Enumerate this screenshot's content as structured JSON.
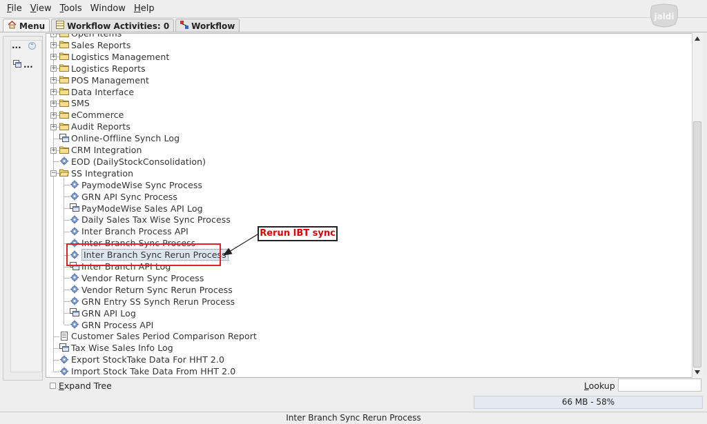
{
  "menubar": {
    "items": [
      {
        "key": "F",
        "rest": "ile"
      },
      {
        "key": "V",
        "rest": "iew"
      },
      {
        "key": "T",
        "rest": "ools"
      },
      {
        "key": "W",
        "rest": "indow",
        "nounderline": true
      },
      {
        "key": "H",
        "rest": "elp"
      }
    ]
  },
  "logo_text": "jaldi",
  "tabs": {
    "menu": "Menu",
    "workflow_activities": "Workflow Activities: 0",
    "workflow": "Workflow"
  },
  "side": {
    "dots_top": "...",
    "dots_item": "..."
  },
  "tree": {
    "items": [
      {
        "label": "Open Items",
        "type": "folder",
        "level": 0,
        "expandable": true,
        "partial": true
      },
      {
        "label": "Sales Reports",
        "type": "folder",
        "level": 0,
        "expandable": true
      },
      {
        "label": "Logistics Management",
        "type": "folder",
        "level": 0,
        "expandable": true
      },
      {
        "label": "Logistics Reports",
        "type": "folder",
        "level": 0,
        "expandable": true
      },
      {
        "label": "POS Management",
        "type": "folder",
        "level": 0,
        "expandable": true
      },
      {
        "label": "Data Interface",
        "type": "folder",
        "level": 0,
        "expandable": true
      },
      {
        "label": "SMS",
        "type": "folder",
        "level": 0,
        "expandable": true
      },
      {
        "label": "eCommerce",
        "type": "folder",
        "level": 0,
        "expandable": true
      },
      {
        "label": "Audit Reports",
        "type": "folder",
        "level": 0,
        "expandable": true
      },
      {
        "label": "Online-Offline Synch Log",
        "type": "window",
        "level": 0,
        "expandable": false
      },
      {
        "label": "CRM Integration",
        "type": "folder",
        "level": 0,
        "expandable": true
      },
      {
        "label": "EOD (DailyStockConsolidation)",
        "type": "process",
        "level": 0,
        "expandable": false
      },
      {
        "label": "SS Integration",
        "type": "folder-open",
        "level": 0,
        "expandable": true,
        "expanded": true
      },
      {
        "label": "PaymodeWise Sync Process",
        "type": "process",
        "level": 1
      },
      {
        "label": "GRN API Sync Process",
        "type": "process",
        "level": 1
      },
      {
        "label": "PayModeWise Sales API Log",
        "type": "window",
        "level": 1
      },
      {
        "label": "Daily Sales Tax Wise Sync Process",
        "type": "process",
        "level": 1
      },
      {
        "label": "Inter Branch Process API",
        "type": "process",
        "level": 1
      },
      {
        "label": "Inter Branch Sync Process",
        "type": "process",
        "level": 1
      },
      {
        "label": "Inter Branch Sync Rerun Process",
        "type": "process",
        "level": 1,
        "selected": true
      },
      {
        "label": "Inter Branch API Log",
        "type": "window",
        "level": 1
      },
      {
        "label": "Vendor Return Sync Process",
        "type": "process",
        "level": 1
      },
      {
        "label": "Vendor Return Sync Rerun Process",
        "type": "process",
        "level": 1
      },
      {
        "label": "GRN Entry SS Synch Rerun Process",
        "type": "process",
        "level": 1
      },
      {
        "label": "GRN API Log",
        "type": "window",
        "level": 1
      },
      {
        "label": "GRN Process API",
        "type": "process",
        "level": 1
      },
      {
        "label": "Customer Sales Period Comparison Report",
        "type": "report",
        "level": 0
      },
      {
        "label": "Tax Wise Sales Info Log",
        "type": "window",
        "level": 0
      },
      {
        "label": "Export StockTake Data For HHT 2.0",
        "type": "process",
        "level": 0
      },
      {
        "label": "Import Stock Take Data From HHT 2.0",
        "type": "process",
        "level": 0
      }
    ]
  },
  "bottom": {
    "expand_tree_label": "Expand Tree",
    "expand_tree_key": "E",
    "lookup_label": "Lookup",
    "lookup_key": "L",
    "lookup_value": ""
  },
  "memory": "66 MB - 58%",
  "status": "Inter Branch Sync Rerun Process",
  "annotation": {
    "callout": "Rerun IBT sync",
    "accent": "#e02020"
  }
}
